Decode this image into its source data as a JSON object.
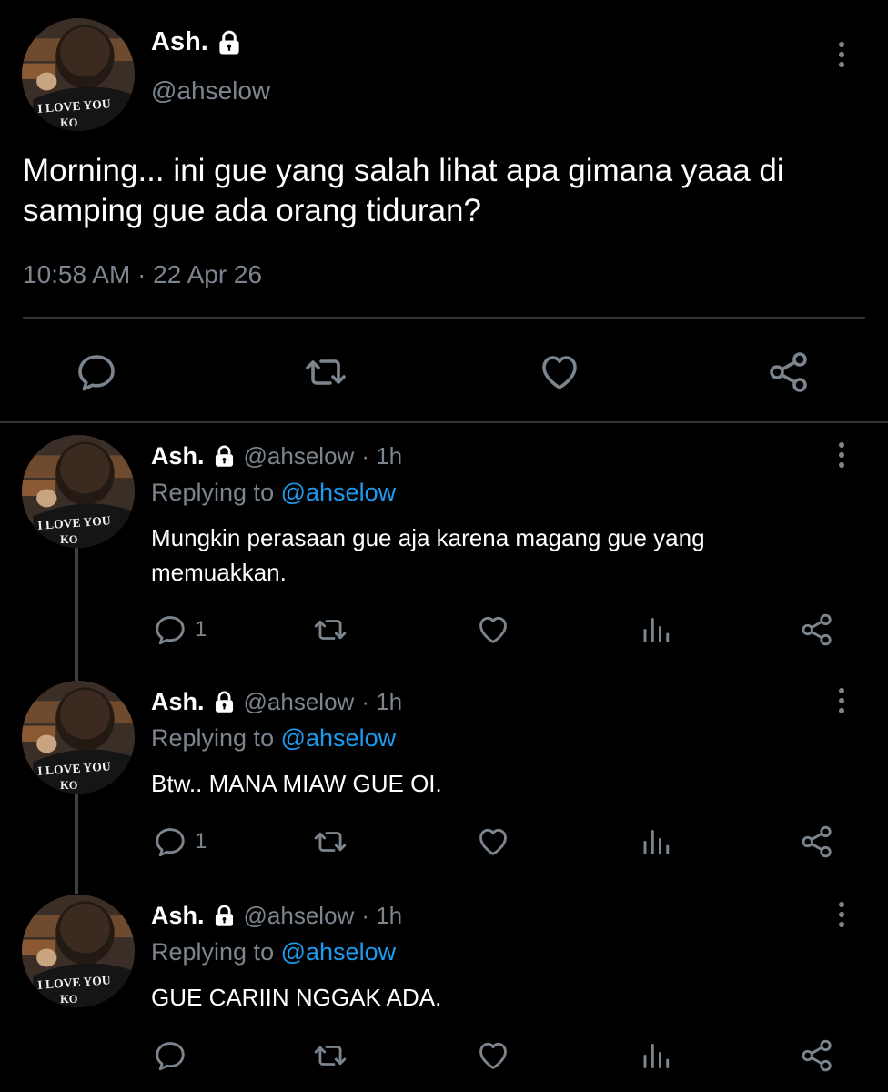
{
  "colors": {
    "background": "#000000",
    "muted": "#7c858d",
    "link": "#1d9bf0",
    "divider": "#2f3336"
  },
  "main_tweet": {
    "name": "Ash.",
    "handle": "@ahselow",
    "text": "Morning... ini gue yang salah lihat apa gimana yaaa di samping gue ada orang tiduran?",
    "timestamp": "10:58 AM · 22 Apr 26",
    "avatar_text": "I LOVE YOU",
    "icons": [
      "reply-icon",
      "retweet-icon",
      "like-icon",
      "share-icon",
      "lock-icon",
      "more-icon"
    ]
  },
  "replies": [
    {
      "name": "Ash.",
      "handle": "@ahselow",
      "time": "· 1h",
      "replying_prefix": "Replying to",
      "replying_to": "@ahselow",
      "text": "Mungkin perasaan gue aja karena magang gue yang memuakkan.",
      "reply_count": "1",
      "avatar_text": "I LOVE YOU"
    },
    {
      "name": "Ash.",
      "handle": "@ahselow",
      "time": "· 1h",
      "replying_prefix": "Replying to",
      "replying_to": "@ahselow",
      "text": "Btw.. MANA MIAW GUE OI.",
      "reply_count": "1",
      "avatar_text": "I LOVE YOU"
    },
    {
      "name": "Ash.",
      "handle": "@ahselow",
      "time": "· 1h",
      "replying_prefix": "Replying to",
      "replying_to": "@ahselow",
      "text": "GUE CARIIN NGGAK ADA.",
      "reply_count": "",
      "avatar_text": "I LOVE YOU"
    }
  ]
}
